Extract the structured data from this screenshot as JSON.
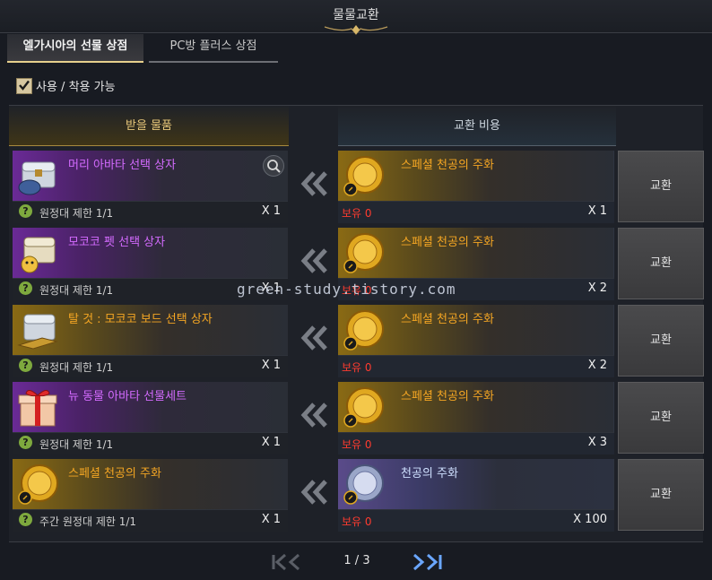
{
  "window": {
    "title": "물물교환"
  },
  "tabs": [
    {
      "label": "엘가시아의 선물 상점",
      "active": true
    },
    {
      "label": "PC방 플러스 상점",
      "active": false
    }
  ],
  "filter": {
    "label": "사용 / 착용 가능",
    "checked": true
  },
  "columns": {
    "receive": "받을 물품",
    "cost": "교환 비용"
  },
  "rows": [
    {
      "item": {
        "name": "머리 아바타 선택 상자",
        "grade": "purple",
        "icon": "chest-helmet-icon",
        "limit": "원정대 제한 1/1",
        "qty": "X 1"
      },
      "cost": {
        "name": "스페셜 천공의 주화",
        "icon": "gold-coin-icon",
        "owned": "보유 0",
        "qty": "X 1"
      },
      "button": "교환"
    },
    {
      "item": {
        "name": "모코코 펫 선택 상자",
        "grade": "purple",
        "icon": "chest-pet-icon",
        "limit": "원정대 제한 1/1",
        "qty": "X 1"
      },
      "cost": {
        "name": "스페셜 천공의 주화",
        "icon": "gold-coin-icon",
        "owned": "보유 0",
        "qty": "X 2"
      },
      "button": "교환"
    },
    {
      "item": {
        "name": "탈 것 : 모코코 보드 선택 상자",
        "grade": "orange",
        "icon": "chest-mount-icon",
        "limit": "원정대 제한 1/1",
        "qty": "X 1"
      },
      "cost": {
        "name": "스페셜 천공의 주화",
        "icon": "gold-coin-icon",
        "owned": "보유 0",
        "qty": "X 2"
      },
      "button": "교환"
    },
    {
      "item": {
        "name": "뉴 동물 아바타 선물세트",
        "grade": "purple",
        "icon": "gift-box-icon",
        "limit": "원정대 제한 1/1",
        "qty": "X 1"
      },
      "cost": {
        "name": "스페셜 천공의 주화",
        "icon": "gold-coin-icon",
        "owned": "보유 0",
        "qty": "X 3"
      },
      "button": "교환"
    },
    {
      "item": {
        "name": "스페셜 천공의 주화",
        "grade": "orange",
        "icon": "gold-coin-icon",
        "limit": "주간 원정대 제한 1/1",
        "qty": "X 1"
      },
      "cost": {
        "name": "천공의 주화",
        "icon": "silver-coin-icon",
        "owned": "보유 0",
        "qty": "X 100"
      },
      "button": "교환"
    }
  ],
  "pager": {
    "text": "1 / 3"
  },
  "watermark": "green-study.tistory.com",
  "colors": {
    "accent_gold": "#e8c87a",
    "owned_red": "#ff3b2f",
    "purple_name": "#d46bff",
    "orange_name": "#f5a623"
  }
}
